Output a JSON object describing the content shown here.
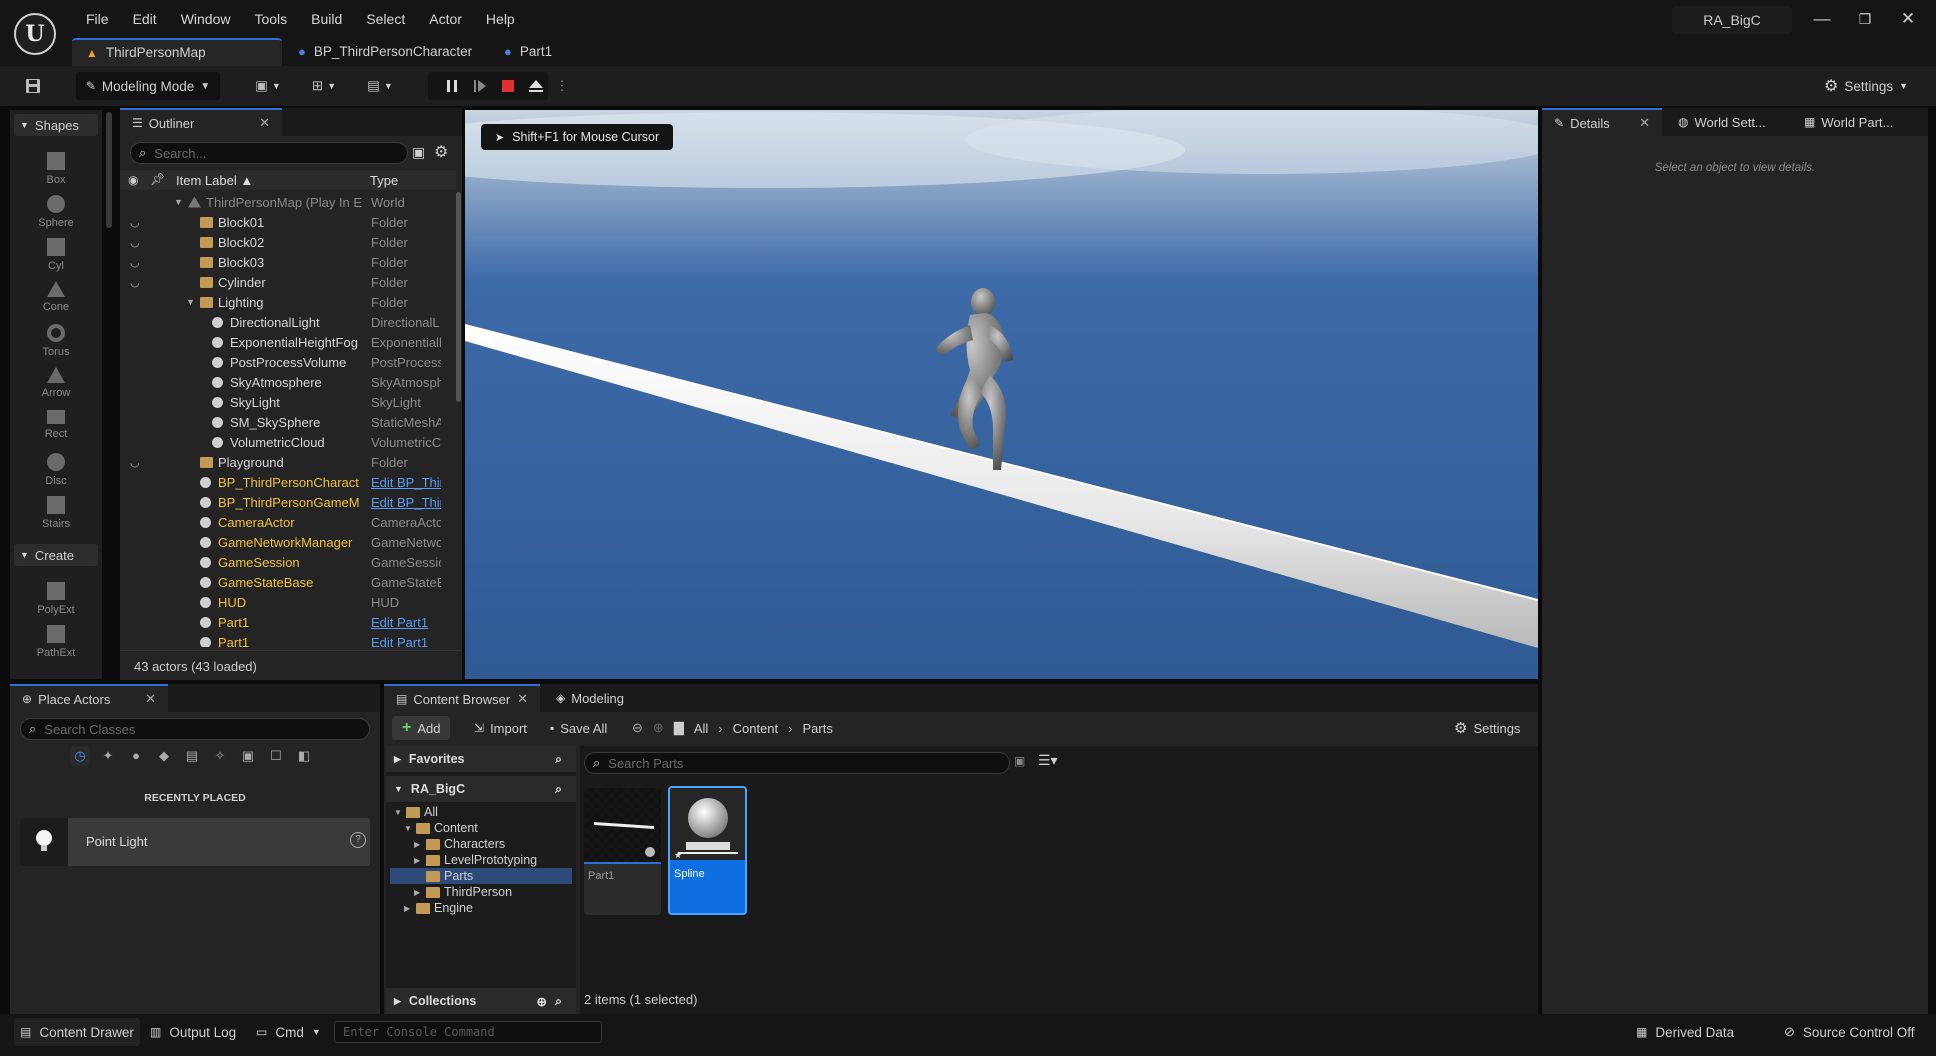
{
  "app": {
    "project_name": "RA_BigC",
    "menu": [
      "File",
      "Edit",
      "Window",
      "Tools",
      "Build",
      "Select",
      "Actor",
      "Help"
    ],
    "window_controls": {
      "minimize": "—",
      "restore": "❐",
      "close": "✕"
    }
  },
  "doc_tabs": [
    {
      "label": "ThirdPersonMap",
      "icon": "level-icon",
      "active": true
    },
    {
      "label": "BP_ThirdPersonCharacter",
      "icon": "blueprint-icon",
      "active": false
    },
    {
      "label": "Part1",
      "icon": "blueprint-icon",
      "active": false
    }
  ],
  "toolbar": {
    "mode_label": "Modeling Mode",
    "settings_label": "Settings"
  },
  "modeling_tools": {
    "shapes_header": "Shapes",
    "shapes": [
      "Box",
      "Sphere",
      "Cyl",
      "Cone",
      "Torus",
      "Arrow",
      "Rect",
      "Disc",
      "Stairs"
    ],
    "create_header": "Create",
    "create": [
      "PolyExt",
      "PathExt"
    ]
  },
  "outliner": {
    "tab_label": "Outliner",
    "search_placeholder": "Search...",
    "col_label": "Item Label ▲",
    "col_type": "Type",
    "rows": [
      {
        "name": "ThirdPersonMap (Play In E",
        "type": "World",
        "indent": 0,
        "kind": "world"
      },
      {
        "name": "Block01",
        "type": "Folder",
        "indent": 1,
        "kind": "folder",
        "eye": true
      },
      {
        "name": "Block02",
        "type": "Folder",
        "indent": 1,
        "kind": "folder",
        "eye": true
      },
      {
        "name": "Block03",
        "type": "Folder",
        "indent": 1,
        "kind": "folder",
        "eye": true
      },
      {
        "name": "Cylinder",
        "type": "Folder",
        "indent": 1,
        "kind": "folder",
        "eye": true
      },
      {
        "name": "Lighting",
        "type": "Folder",
        "indent": 1,
        "kind": "folder"
      },
      {
        "name": "DirectionalLight",
        "type": "DirectionalL",
        "indent": 2,
        "kind": "actor"
      },
      {
        "name": "ExponentialHeightFog",
        "type": "Exponentiall",
        "indent": 2,
        "kind": "actor"
      },
      {
        "name": "PostProcessVolume",
        "type": "PostProcess",
        "indent": 2,
        "kind": "actor"
      },
      {
        "name": "SkyAtmosphere",
        "type": "SkyAtmosph",
        "indent": 2,
        "kind": "actor"
      },
      {
        "name": "SkyLight",
        "type": "SkyLight",
        "indent": 2,
        "kind": "actor"
      },
      {
        "name": "SM_SkySphere",
        "type": "StaticMeshA",
        "indent": 2,
        "kind": "actor"
      },
      {
        "name": "VolumetricCloud",
        "type": "VolumetricC",
        "indent": 2,
        "kind": "actor"
      },
      {
        "name": "Playground",
        "type": "Folder",
        "indent": 1,
        "kind": "folder",
        "eye": true
      },
      {
        "name": "BP_ThirdPersonCharact",
        "type": "Edit BP_Thir",
        "indent": 1,
        "kind": "actor",
        "yellow": true,
        "link": true
      },
      {
        "name": "BP_ThirdPersonGameM",
        "type": "Edit BP_Thir",
        "indent": 1,
        "kind": "actor",
        "yellow": true,
        "link": true
      },
      {
        "name": "CameraActor",
        "type": "CameraActo",
        "indent": 1,
        "kind": "actor",
        "yellow": true
      },
      {
        "name": "GameNetworkManager",
        "type": "GameNetwo",
        "indent": 1,
        "kind": "actor",
        "yellow": true
      },
      {
        "name": "GameSession",
        "type": "GameSessic",
        "indent": 1,
        "kind": "actor",
        "yellow": true
      },
      {
        "name": "GameStateBase",
        "type": "GameStateE",
        "indent": 1,
        "kind": "actor",
        "yellow": true
      },
      {
        "name": "HUD",
        "type": "HUD",
        "indent": 1,
        "kind": "actor",
        "yellow": true
      },
      {
        "name": "Part1",
        "type": "Edit Part1",
        "indent": 1,
        "kind": "actor",
        "yellow": true,
        "link": true
      },
      {
        "name": "Part1",
        "type": "Edit Part1",
        "indent": 1,
        "kind": "actor",
        "yellow": true,
        "link": true
      }
    ],
    "status": "43 actors (43 loaded)"
  },
  "viewport": {
    "hint": "Shift+F1 for Mouse Cursor"
  },
  "details": {
    "tabs": [
      "Details",
      "World Sett...",
      "World Part..."
    ],
    "empty_message": "Select an object to view details."
  },
  "place_actors": {
    "tab_label": "Place Actors",
    "search_placeholder": "Search Classes",
    "section": "RECENTLY PLACED",
    "items": [
      {
        "label": "Point Light"
      }
    ]
  },
  "content_browser": {
    "tabs": [
      "Content Browser",
      "Modeling"
    ],
    "add_label": "Add",
    "import_label": "Import",
    "save_all_label": "Save All",
    "breadcrumb": [
      "All",
      "Content",
      "Parts"
    ],
    "settings_label": "Settings",
    "favorites_label": "Favorites",
    "project_label": "RA_BigC",
    "tree": [
      {
        "label": "All",
        "depth": 0,
        "arrow": "▼"
      },
      {
        "label": "Content",
        "depth": 1,
        "arrow": "▼"
      },
      {
        "label": "Characters",
        "depth": 2,
        "arrow": "▶"
      },
      {
        "label": "LevelPrototyping",
        "depth": 2,
        "arrow": "▶"
      },
      {
        "label": "Parts",
        "depth": 2,
        "arrow": "",
        "selected": true
      },
      {
        "label": "ThirdPerson",
        "depth": 2,
        "arrow": "▶"
      },
      {
        "label": "Engine",
        "depth": 1,
        "arrow": "▶"
      }
    ],
    "collections_label": "Collections",
    "search_placeholder": "Search Parts",
    "assets": [
      {
        "label": "Part1",
        "selected": false
      },
      {
        "label": "Spline",
        "selected": true
      }
    ],
    "status": "2 items (1 selected)"
  },
  "statusbar": {
    "content_drawer": "Content Drawer",
    "output_log": "Output Log",
    "cmd": "Cmd",
    "console_placeholder": "Enter Console Command",
    "derived_data": "Derived Data",
    "source_control": "Source Control Off"
  }
}
